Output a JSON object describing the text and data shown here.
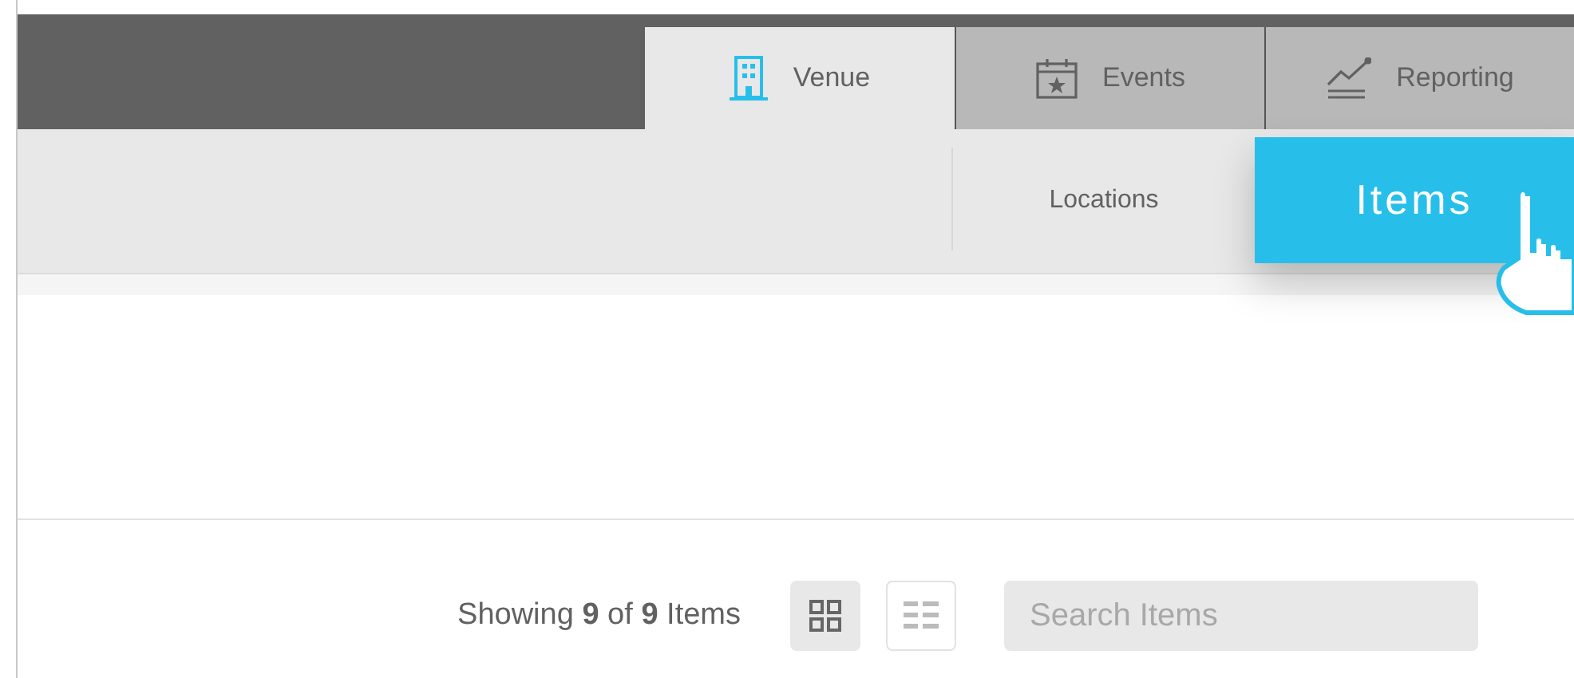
{
  "tabs": [
    {
      "label": "Venue",
      "selected": true
    },
    {
      "label": "Events",
      "selected": false
    },
    {
      "label": "Reporting",
      "selected": false
    }
  ],
  "subnav": [
    {
      "label": "Locations",
      "selected": false
    },
    {
      "label": "Items",
      "selected": true
    }
  ],
  "toolbar": {
    "summary": "Showing **9** of **9** Items",
    "view_toggles": [
      {
        "selected": true
      },
      {
        "selected": false
      }
    ],
    "search": {
      "placeholder": "Search Items"
    }
  }
}
